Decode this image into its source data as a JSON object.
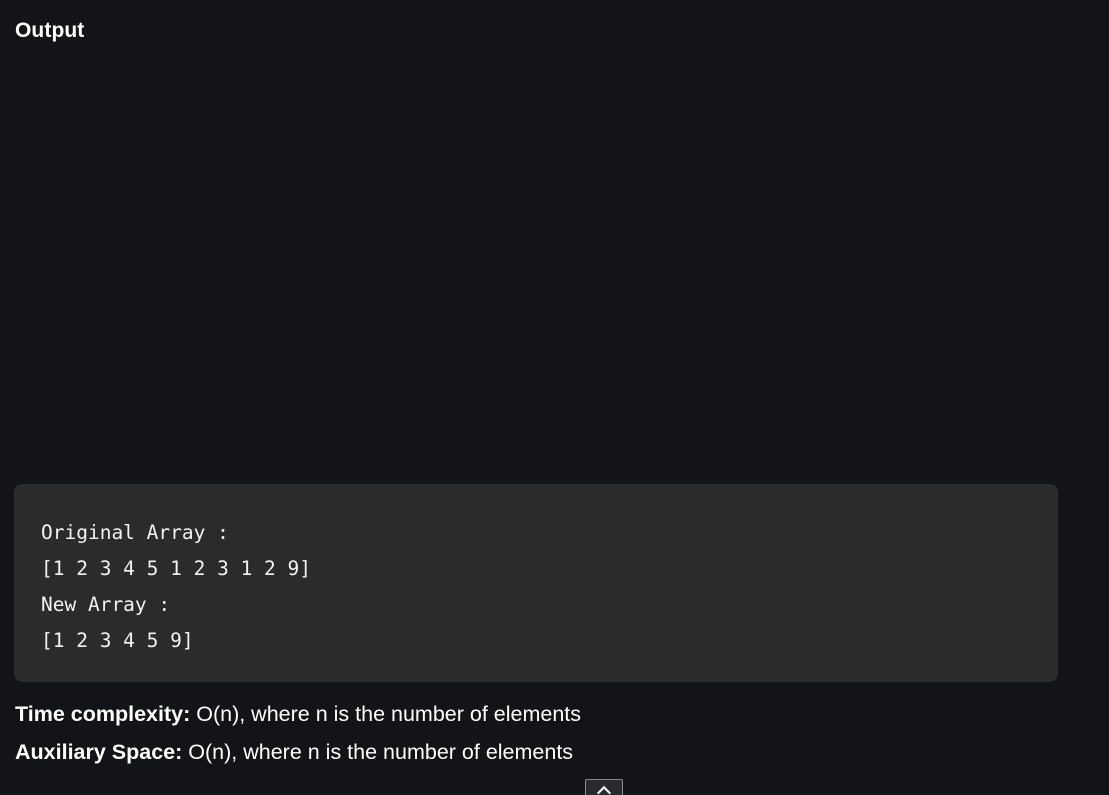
{
  "section": {
    "heading": "Output"
  },
  "output": {
    "lines": [
      "Original Array :",
      "[1 2 3 4 5 1 2 3 1 2 9]",
      "New Array :",
      "[1 2 3 4 5 9]"
    ]
  },
  "complexity": {
    "time_label": "Time complexity:",
    "time_value": " O(n), where n is the number of elements",
    "space_label": "Auxiliary Space:",
    "space_value": " O(n), where n is the number of elements"
  },
  "icons": {
    "scroll_top": "chevron-up-icon"
  }
}
